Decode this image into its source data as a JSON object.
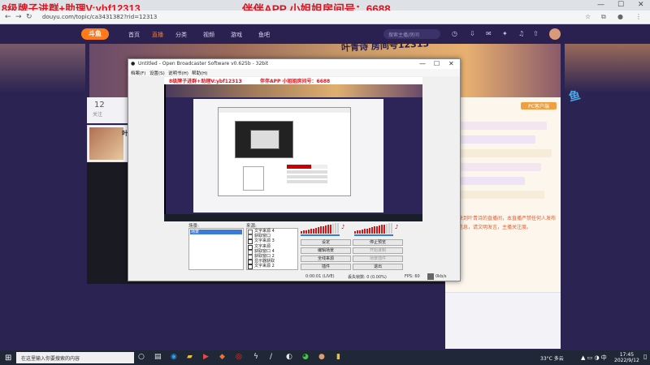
{
  "overlay": {
    "left_text": "8级牌子进群+助理V:ybf12313",
    "right_text": "伴伴APP  小姐姐房间号：6688"
  },
  "browser": {
    "url": "douyu.com/topic/ca3431382?rid=12313",
    "nav": {
      "back": "←",
      "forward": "→",
      "reload": "↻"
    }
  },
  "site": {
    "logo": "斗鱼",
    "nav_items": [
      "首页",
      "直播",
      "分类",
      "视频",
      "游戏",
      "鱼吧"
    ],
    "active_nav": "直播",
    "search_placeholder": "搜索主播/房间",
    "banner_text": "叶青诗 房间号12313",
    "follow_count": "12",
    "follow_label": "关注",
    "host_name": "叶",
    "rank_button": "PC客户端",
    "orange_text": "欢迎来到叶青诗的直播间，本直播严禁任何人发布违规信息，请文明发言，主播关注度。"
  },
  "obs": {
    "title": "Untitled - Open Broadcaster Software v0.625b - 32bit",
    "menu": [
      "档案(F)",
      "设置(S)",
      "说明书(H)",
      "帮助(H)"
    ],
    "preview_left": "8级牌子进群+助理V:ybf12313",
    "preview_right": "伴伴APP  小姐姐房间号：6688",
    "scenes_label": "场景:",
    "scenes": [
      "场景"
    ],
    "sources_label": "来源:",
    "sources": [
      "文字来源 4",
      "获取窗口",
      "文字来源 3",
      "文字来源",
      "获取窗口 4",
      "获取窗口 2",
      "显示器获取",
      "文字来源 2"
    ],
    "buttons": {
      "settings": "设定",
      "stop_preview": "停止预览",
      "edit_scene": "编辑场景",
      "start_recording": "开始录制",
      "fullscreen": "全线来源",
      "scene_plugin": "场景插件",
      "plugins": "插件",
      "exit": "退出"
    },
    "status": {
      "time": "0:00:01 (LIVE)",
      "dropped": "丢失帧数: 0 (0.00%)",
      "fps": "FPS: 60",
      "bitrate": "0kb/s"
    }
  },
  "taskbar": {
    "search_placeholder": "在这里输入你要搜索的内容",
    "temp": "33°C  多云",
    "time": "17:45",
    "date": "2022/9/12"
  }
}
